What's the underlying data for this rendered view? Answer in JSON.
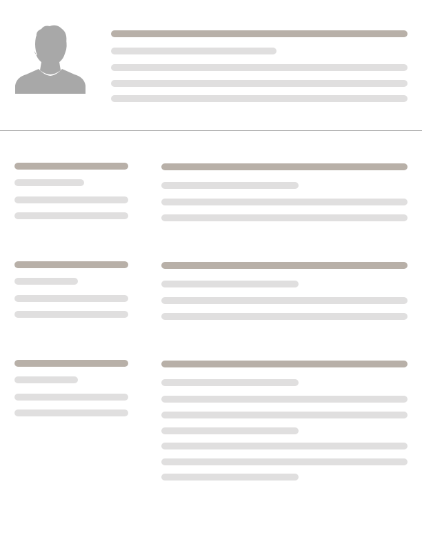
{
  "document": {
    "type": "resume-template-placeholder",
    "colors": {
      "heading_bar": "#b8b0a8",
      "text_bar": "#e0dfdf",
      "avatar": "#a8a8a8",
      "divider": "#a6a6a6",
      "background": "#ffffff"
    },
    "header": {
      "avatar_icon": "person-silhouette-icon",
      "placeholder_lines": 5
    },
    "sections": [
      {
        "sidebar_lines": 4,
        "main_lines": 4
      },
      {
        "sidebar_lines": 4,
        "main_lines": 4
      },
      {
        "sidebar_lines": 4,
        "main_lines": 8
      }
    ]
  }
}
